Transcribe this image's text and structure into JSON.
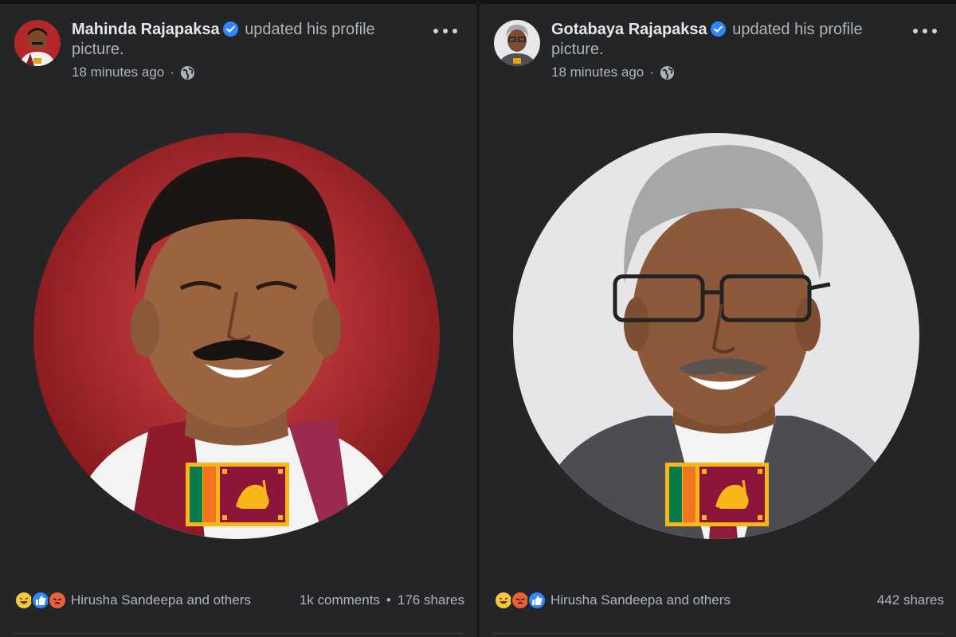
{
  "posts": [
    {
      "author": "Mahinda Rajapaksa",
      "action": "updated his profile picture.",
      "time": "18 minutes ago",
      "privacy_icon": "globe-icon",
      "reactions": [
        "haha",
        "like",
        "angry"
      ],
      "reactors": "Hirusha Sandeepa and others",
      "comments": "1k comments",
      "shares": "176 shares",
      "photo_bg": "#a61e22"
    },
    {
      "author": "Gotabaya Rajapaksa",
      "action": "updated his profile picture.",
      "time": "18 minutes ago",
      "privacy_icon": "globe-icon",
      "reactions": [
        "haha",
        "angry",
        "like"
      ],
      "reactors": "Hirusha Sandeepa and others",
      "comments": "",
      "shares": "442 shares",
      "photo_bg": "#e6e6e8"
    }
  ],
  "colors": {
    "background": "#242526",
    "verified": "#2d88ff",
    "text_primary": "#e4e6eb",
    "text_secondary": "#b0b3b8"
  }
}
